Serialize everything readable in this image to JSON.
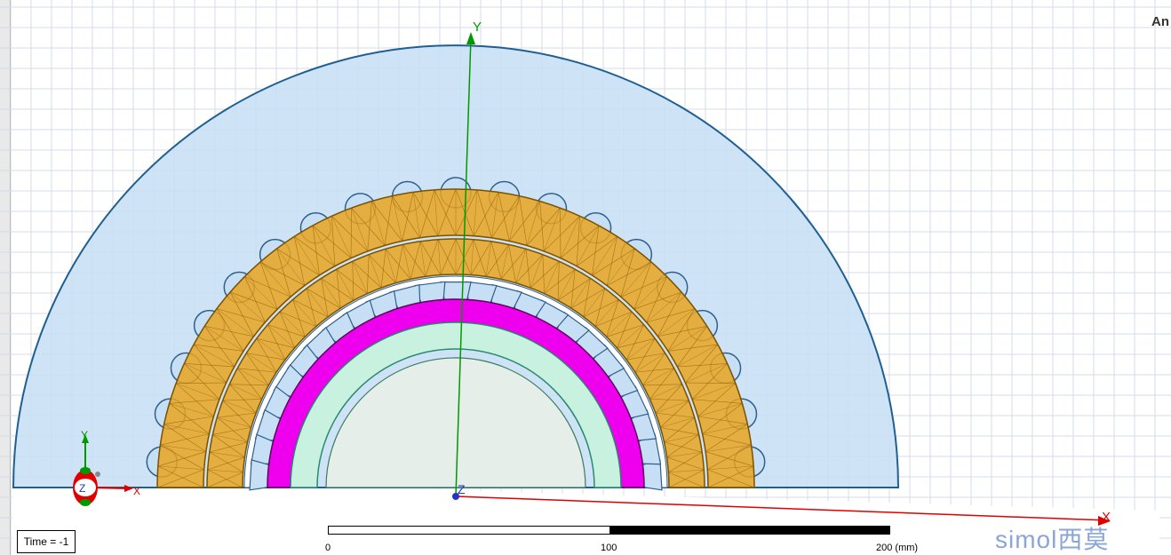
{
  "header": {
    "corner_label": "An"
  },
  "axes": {
    "y_label": "Y",
    "x_label": "X",
    "z_label": "Z"
  },
  "triad": {
    "y_label": "Y",
    "x_label": "X",
    "z_label": "Z"
  },
  "status": {
    "time_text": "Time = -1"
  },
  "scale_bar": {
    "tick0": "0",
    "tick1": "100",
    "tick2": "200 (mm)"
  },
  "watermark": {
    "text": "simol西莫"
  },
  "colors": {
    "background_grid": "#d4dbe8",
    "air_region": "#c6dff5",
    "air_outline": "#1f5f91",
    "stator_winding": "#e8a520",
    "stator_teeth_outline": "#2f5f8a",
    "rotor_ring": "#ee00ee",
    "inner_ring": "#c8f1e0",
    "shaft": "#e5eee8",
    "axis_x": "#e00000",
    "axis_y": "#009900"
  }
}
